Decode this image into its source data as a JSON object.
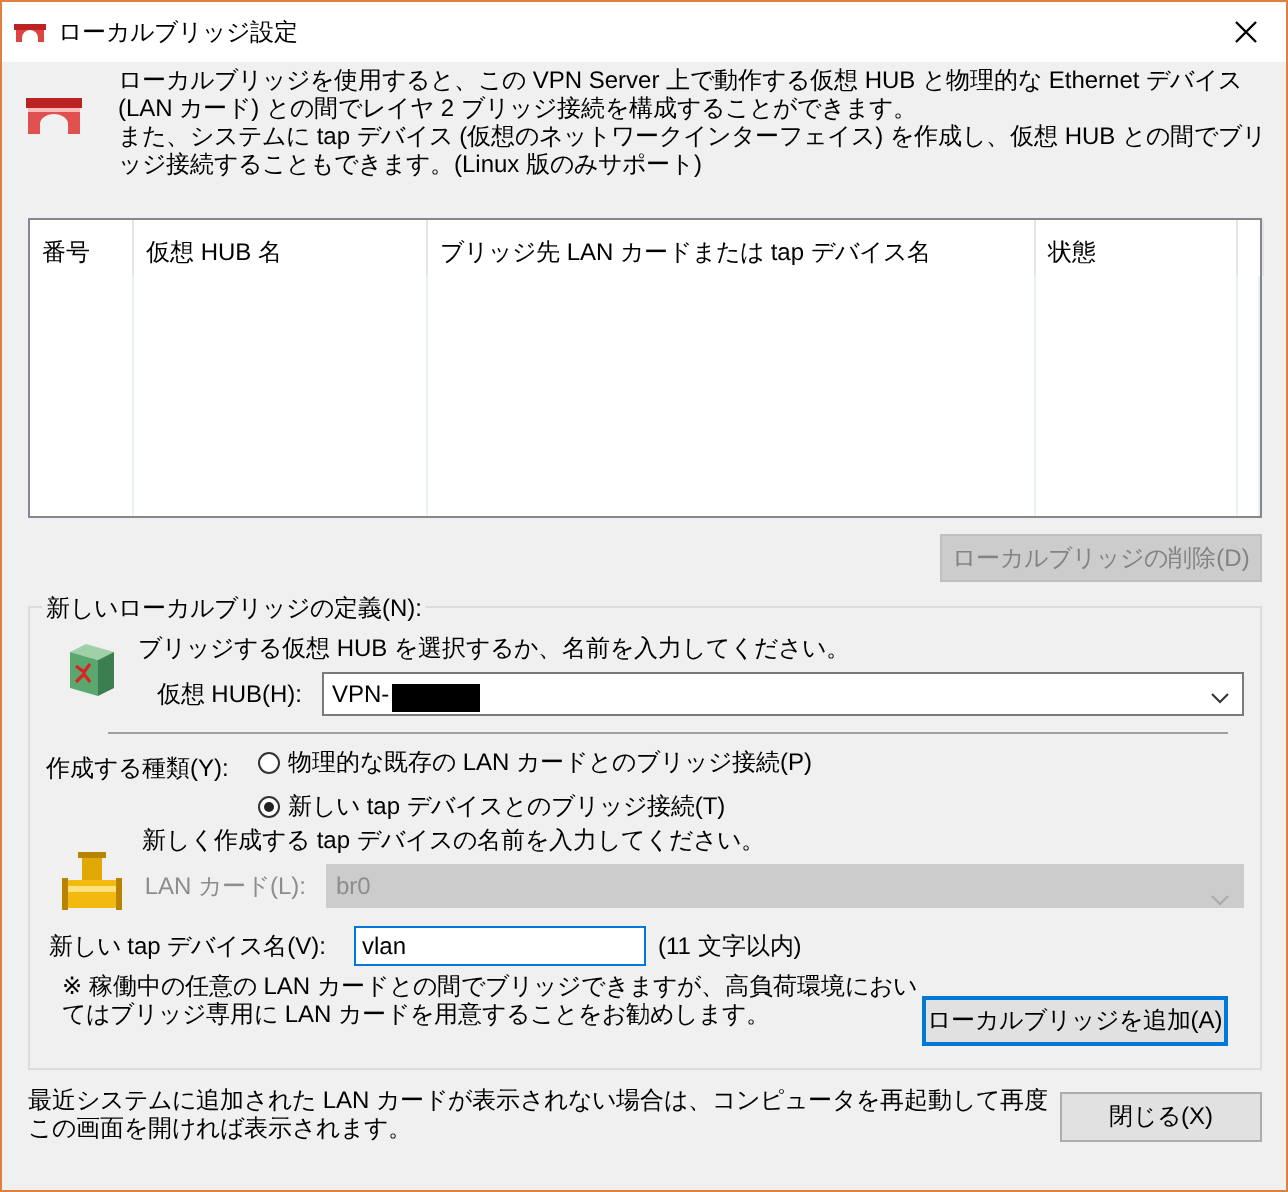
{
  "window": {
    "title": "ローカルブリッジ設定"
  },
  "intro": [
    "ローカルブリッジを使用すると、この VPN Server 上で動作する仮想 HUB と物理的な Ethernet デバイス (LAN カード) との間でレイヤ 2 ブリッジ接続を構成することができます。",
    "また、システムに tap デバイス (仮想のネットワークインターフェイス) を作成し、仮想 HUB との間でブリッジ接続することもできます。(Linux 版のみサポート)"
  ],
  "bridge_table": {
    "columns": [
      "番号",
      "仮想 HUB 名",
      "ブリッジ先 LAN カードまたは tap デバイス名",
      "状態"
    ]
  },
  "delete_button": {
    "label": "ローカルブリッジの削除(D)",
    "disabled": true
  },
  "new_bridge": {
    "legend": "新しいローカルブリッジの定義(N):",
    "hub_prompt": "ブリッジする仮想 HUB を選択するか、名前を入力してください。",
    "hub_label": "仮想 HUB(H):",
    "hub_value": "VPN-",
    "type_label": "作成する種類(Y):",
    "types": [
      {
        "label": "物理的な既存の LAN カードとのブリッジ接続(P)",
        "selected": false
      },
      {
        "label": "新しい tap デバイスとのブリッジ接続(T)",
        "selected": true
      }
    ],
    "tap_prompt": "新しく作成する tap デバイスの名前を入力してください。",
    "lan_label": "LAN カード(L):",
    "lan_value": "br0",
    "lan_disabled": true,
    "tap_name_label": "新しい tap デバイス名(V):",
    "tap_name_value": "vlan",
    "tap_name_hint": "(11 文字以内)",
    "note": "※ 稼働中の任意の LAN カードとの間でブリッジできますが、高負荷環境においてはブリッジ専用に LAN カードを用意することをお勧めします。",
    "add_button": {
      "label": "ローカルブリッジを追加(A)",
      "focused": true
    }
  },
  "footer": {
    "note": "最近システムに追加された LAN カードが表示されない場合は、コンピュータを再起動して再度この画面を開ければ表示されます。",
    "close_button": "閉じる(X)"
  }
}
